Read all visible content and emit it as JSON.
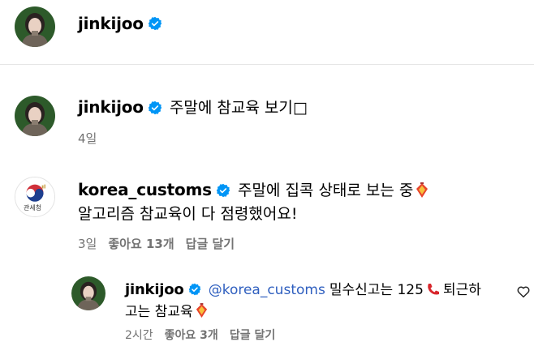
{
  "header": {
    "username": "jinkijoo"
  },
  "comments": [
    {
      "username": "jinkijoo",
      "text": "주말에 참교육 보기",
      "emoji": "□",
      "time": "4일"
    },
    {
      "username": "korea_customs",
      "avatar_label": "관세청",
      "line1": "주말에 집콕 상태로 보는 중",
      "line2": "알고리즘 참교육이 다 점령했어요!",
      "time": "3일",
      "likes": "좋아요 13개",
      "reply": "답글 달기"
    }
  ],
  "reply": {
    "username": "jinkijoo",
    "mention": "@korea_customs",
    "line1": "밀수신고는 125",
    "line1_tail": "퇴근하",
    "line2": "고는 참교육",
    "time": "2시간",
    "likes": "좋아요 3개",
    "reply_label": "답글 달기"
  },
  "colors": {
    "verified": "#0095f6",
    "mention": "#2f5fbf",
    "meta": "#737373"
  }
}
